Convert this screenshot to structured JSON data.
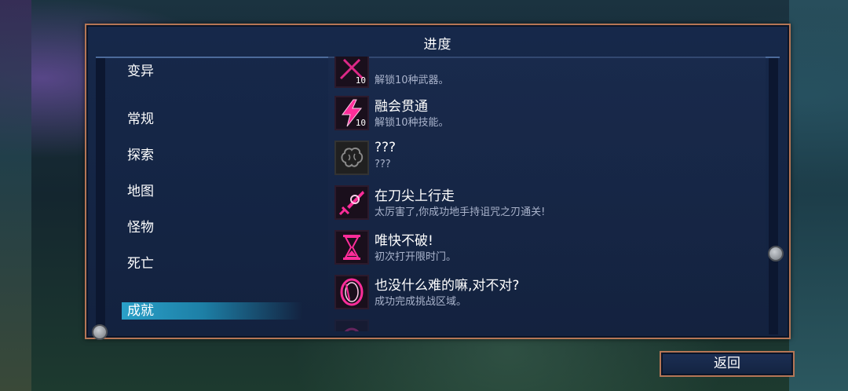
{
  "window": {
    "title": "进度"
  },
  "categories": [
    {
      "label": "变异"
    },
    {
      "label": "常规"
    },
    {
      "label": "探索"
    },
    {
      "label": "地图"
    },
    {
      "label": "怪物"
    },
    {
      "label": "死亡"
    },
    {
      "label": "成就",
      "selected": true
    }
  ],
  "achievements": [
    {
      "title": "",
      "desc": "解锁10种武器。",
      "icon": "crossed-swords-icon",
      "badge": "10",
      "partially_visible": true
    },
    {
      "title": "融会贯通",
      "desc": "解锁10种技能。",
      "icon": "lightning-bolt-icon",
      "badge": "10"
    },
    {
      "title": "???",
      "desc": "???",
      "icon": "locked-brain-icon",
      "locked": true
    },
    {
      "title": "在刀尖上行走",
      "desc": "太厉害了,你成功地手持诅咒之刃通关!",
      "icon": "cursed-blade-icon"
    },
    {
      "title": "唯快不破!",
      "desc": "初次打开限时门。",
      "icon": "hourglass-icon"
    },
    {
      "title": "也没什么难的嘛,对不对?",
      "desc": "成功完成挑战区域。",
      "icon": "portal-ring-icon"
    }
  ],
  "footer": {
    "back_label": "返回"
  },
  "colors": {
    "panel_border": "#b57656",
    "accent_selected": "#2aa0c8",
    "icon_glow": "#ff2d9a"
  }
}
